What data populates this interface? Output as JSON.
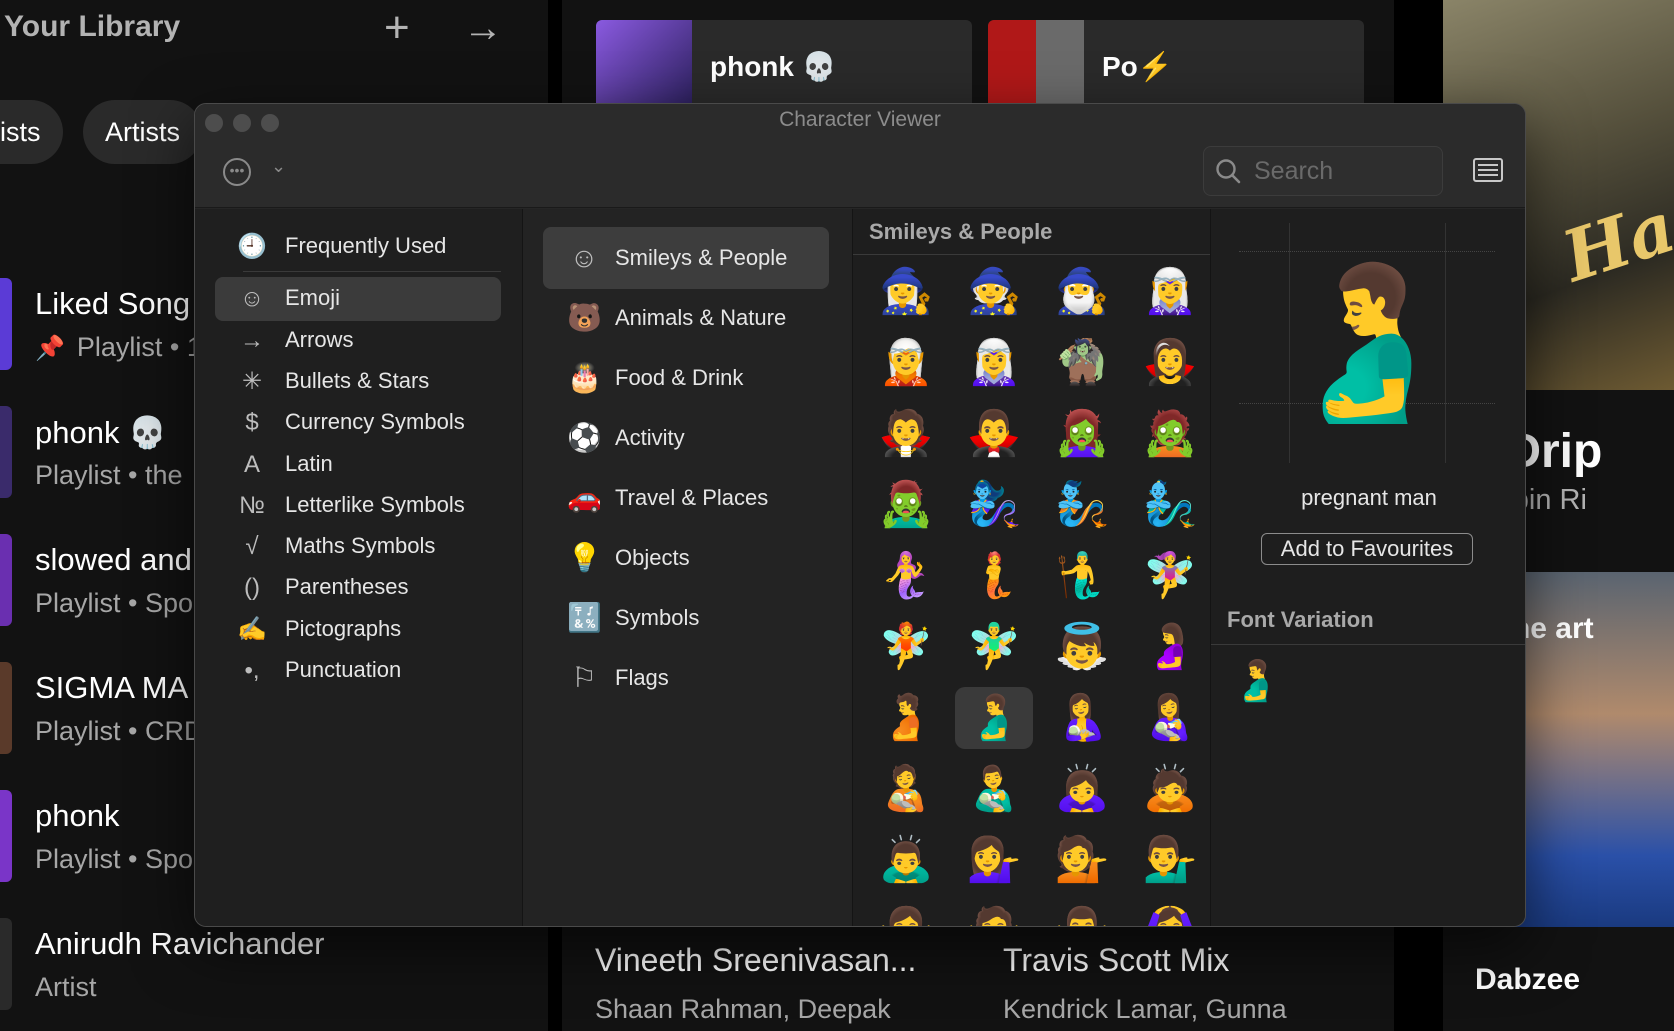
{
  "library": {
    "title": "Your Library",
    "chips": [
      "ists",
      "Artists"
    ],
    "items": [
      {
        "name": "Liked Song",
        "sub": "Playlist • 1",
        "pinned": true,
        "color": "#5b3bd6"
      },
      {
        "name": "phonk 💀",
        "sub": "Playlist • the",
        "pinned": false,
        "color": "#3a2b6b"
      },
      {
        "name": "slowed and",
        "sub": "Playlist • Spo",
        "pinned": false,
        "color": "#6a2fb0"
      },
      {
        "name": "SIGMA MA",
        "sub": "Playlist • CRD",
        "pinned": false,
        "color": "#5a3a2a"
      },
      {
        "name": "phonk",
        "sub": "Playlist • Spo",
        "pinned": false,
        "color": "#7a35c8"
      },
      {
        "name": "Anirudh Ravichander",
        "sub": "Artist",
        "pinned": false,
        "color": "#2a2a2a"
      }
    ]
  },
  "main": {
    "cards": [
      {
        "title": "phonk 💀",
        "color": "#6a3fc2"
      },
      {
        "title": "Po⚡",
        "color": "#8a1a1a"
      }
    ],
    "bottom": [
      {
        "title": "Vineeth Sreenivasan...",
        "sub": "Shaan Rahman, Deepak"
      },
      {
        "title": "Travis Scott Mix",
        "sub": "Kendrick Lamar, Gunna"
      }
    ]
  },
  "right_panel": {
    "title": "ibi Drip",
    "sub": "ee, Ribin Ri",
    "art_text": "Ha",
    "art2_text": "out the art",
    "bottom": "Dabzee"
  },
  "viewer": {
    "title": "Character Viewer",
    "search_placeholder": "Search",
    "categories": [
      {
        "label": "Frequently Used",
        "icon": "clock-icon",
        "glyph": "🕘"
      },
      {
        "label": "Emoji",
        "icon": "smiley-icon",
        "glyph": "☺",
        "selected": true
      },
      {
        "label": "Arrows",
        "icon": "arrow-icon",
        "glyph": "→"
      },
      {
        "label": "Bullets & Stars",
        "icon": "asterisk-icon",
        "glyph": "✳"
      },
      {
        "label": "Currency Symbols",
        "icon": "dollar-icon",
        "glyph": "$"
      },
      {
        "label": "Latin",
        "icon": "letter-a-icon",
        "glyph": "A"
      },
      {
        "label": "Letterlike Symbols",
        "icon": "numero-icon",
        "glyph": "№"
      },
      {
        "label": "Maths Symbols",
        "icon": "square-root-icon",
        "glyph": "√"
      },
      {
        "label": "Parentheses",
        "icon": "parentheses-icon",
        "glyph": "()"
      },
      {
        "label": "Pictographs",
        "icon": "pictograph-icon",
        "glyph": "✍"
      },
      {
        "label": "Punctuation",
        "icon": "comma-icon",
        "glyph": "•,"
      }
    ],
    "subcategories": [
      {
        "label": "Smileys & People",
        "icon": "smiley-icon",
        "glyph": "☺",
        "selected": true
      },
      {
        "label": "Animals & Nature",
        "icon": "bear-icon",
        "glyph": "🐻"
      },
      {
        "label": "Food & Drink",
        "icon": "cake-icon",
        "glyph": "🎂"
      },
      {
        "label": "Activity",
        "icon": "soccer-ball-icon",
        "glyph": "⚽"
      },
      {
        "label": "Travel & Places",
        "icon": "car-icon",
        "glyph": "🚗"
      },
      {
        "label": "Objects",
        "icon": "lightbulb-icon",
        "glyph": "💡"
      },
      {
        "label": "Symbols",
        "icon": "symbols-icon",
        "glyph": "🔣"
      },
      {
        "label": "Flags",
        "icon": "flag-icon",
        "glyph": "⚐"
      }
    ],
    "grid_title": "Smileys & People",
    "emojis": [
      "🧙‍♀️",
      "🧙",
      "🧙‍♂️",
      "🧝‍♀️",
      "🧝",
      "🧝‍♀️",
      "🧌",
      "🧛‍♀️",
      "🧛",
      "🧛‍♂️",
      "🧟‍♀️",
      "🧟",
      "🧟‍♂️",
      "🧞‍♀️",
      "🧞",
      "🧞‍♂️",
      "🧜‍♀️",
      "🧜",
      "🧜‍♂️",
      "🧚‍♀️",
      "🧚",
      "🧚‍♂️",
      "👼",
      "🤰",
      "🫄",
      "🫃",
      "🤱",
      "👩‍🍼",
      "🧑‍🍼",
      "👨‍🍼",
      "🙇‍♀️",
      "🙇",
      "🙇‍♂️",
      "💁‍♀️",
      "💁",
      "💁‍♂️",
      "🙅‍♀️",
      "🙅",
      "🙅‍♂️",
      "🙆‍♀️"
    ],
    "selected_index": 25,
    "selected_char": "🫃",
    "selected_name": "pregnant man",
    "add_fav_label": "Add to Favourites",
    "font_variation_title": "Font Variation",
    "font_variation": "🫃"
  }
}
